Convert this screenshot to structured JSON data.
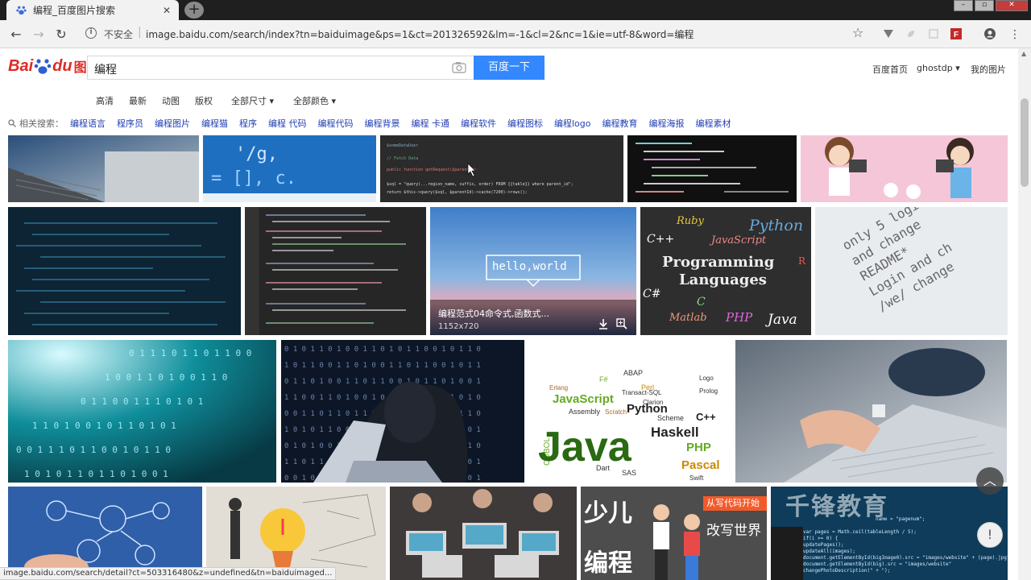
{
  "browser": {
    "tab_title": "编程_百度图片搜索",
    "tab_close": "✕",
    "new_tab": "+",
    "security_label": "不安全",
    "url": "image.baidu.com/search/index?tn=baiduimage&ps=1&ct=201326592&lm=-1&cl=2&nc=1&ie=utf-8&word=编程",
    "status_url": "image.baidu.com/search/detail?ct=503316480&z=undefined&tn=baiduimaged..."
  },
  "header": {
    "logo_bai": "Bai",
    "logo_du": "du",
    "logo_tupian": "图片",
    "search_value": "编程",
    "search_button": "百度一下",
    "links": [
      "百度首页",
      "ghostdp ▾",
      "我的图片"
    ]
  },
  "filters": [
    "高清",
    "最新",
    "动图",
    "版权",
    "全部尺寸 ▾",
    "全部颜色 ▾"
  ],
  "related": {
    "label": "相关搜索：",
    "items": [
      "编程语言",
      "程序员",
      "编程图片",
      "编程猫",
      "程序",
      "编程 代码",
      "编程代码",
      "编程背景",
      "编程 卡通",
      "编程软件",
      "编程图标",
      "编程logo",
      "编程教育",
      "编程海报",
      "编程素材"
    ]
  },
  "images": {
    "hello_world": "hello,world",
    "hover_title": "编程范式04命令式,函数式...",
    "hover_size": "1152x720",
    "prog_lang_title1": "Programming",
    "prog_lang_title2": "Languages",
    "prog_lang_words": [
      "Ruby",
      "Python",
      "C++",
      "JavaScript",
      "C#",
      "R",
      "C",
      "Matlab",
      "PHP",
      "Java"
    ],
    "readme_lines": [
      "only 5 logi",
      "and change",
      "README*",
      "Login and ch",
      "/we/ change"
    ],
    "java_cloud": [
      "ABAP",
      "F#",
      "Erlang",
      "JavaScript",
      "Python",
      "Perl",
      "Logo",
      "Prolog",
      "Transact-SQL",
      "Clarion",
      "Scheme",
      "C++",
      "Haskell",
      "PHP",
      "Pascal",
      "COBOL",
      "Java",
      "Ruby",
      "Assembly",
      "Scratch",
      "Dart",
      "Scala",
      "SAS",
      "Swift",
      "Groovy",
      "Visual Basic"
    ],
    "kids_text1": "少儿",
    "kids_text2": "编程",
    "kids_banner": "从写代码开始",
    "kids_sub": "改写世界"
  },
  "watermark": "千锋教育",
  "colors": {
    "baidu_red": "#de2b25",
    "search_blue": "#3388ff",
    "link_blue": "#2440b3"
  }
}
